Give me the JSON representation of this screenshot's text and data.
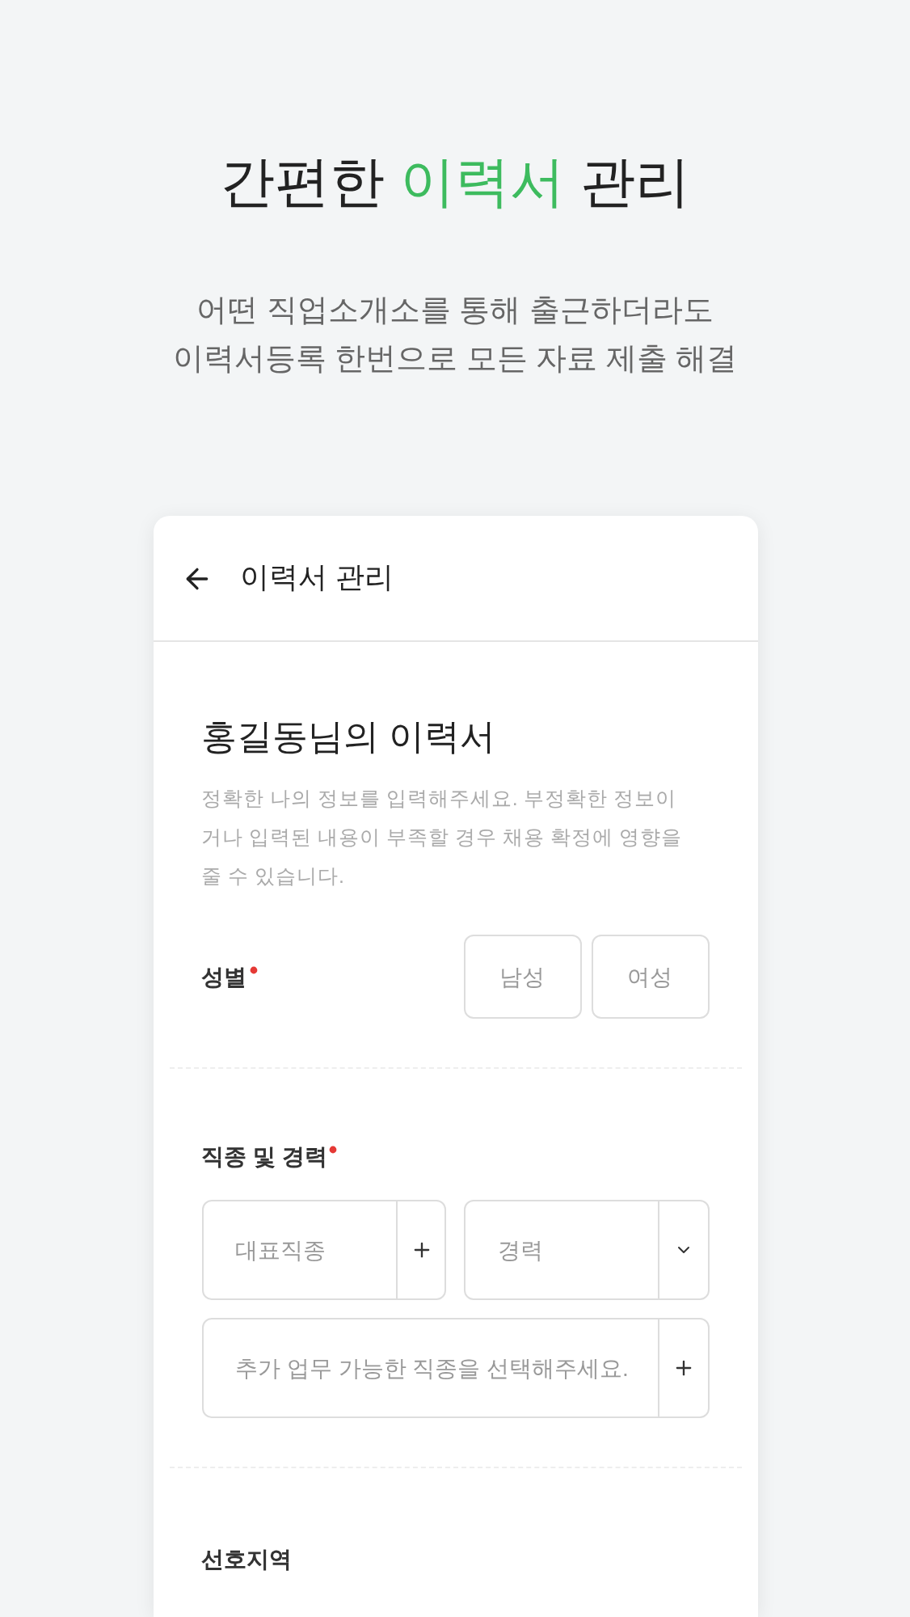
{
  "headline": [
    {
      "text": "간편한 ",
      "highlight": false
    },
    {
      "text": "이력서",
      "highlight": true
    },
    {
      "text": " 관리",
      "highlight": false
    }
  ],
  "subtitle": [
    "어떤 직업소개소를 통해 출근하더라도",
    "이력서등록 한번으로 모든 자료 제출 해결"
  ],
  "app": {
    "header_title": "이력서 관리",
    "resume_title": "홍길동님의 이력서",
    "description": "정확한 나의 정보를 입력해주세요. 부정확한 정보이거나 입력된 내용이 부족할 경우 채용 확정에 영향을 줄 수 있습니다.",
    "gender": {
      "label": "성별",
      "required": true,
      "options": [
        {
          "label": "남성",
          "selected": false
        },
        {
          "label": "여성",
          "selected": false
        }
      ]
    },
    "job": {
      "label": "직종 및 경력",
      "required": true,
      "main_job": {
        "placeholder": "대표직종"
      },
      "career": {
        "placeholder": "경력"
      },
      "extra_job": {
        "placeholder": "추가 업무 가능한 직종을 선택해주세요."
      }
    },
    "region": {
      "label": "선호지역",
      "required": false
    }
  }
}
